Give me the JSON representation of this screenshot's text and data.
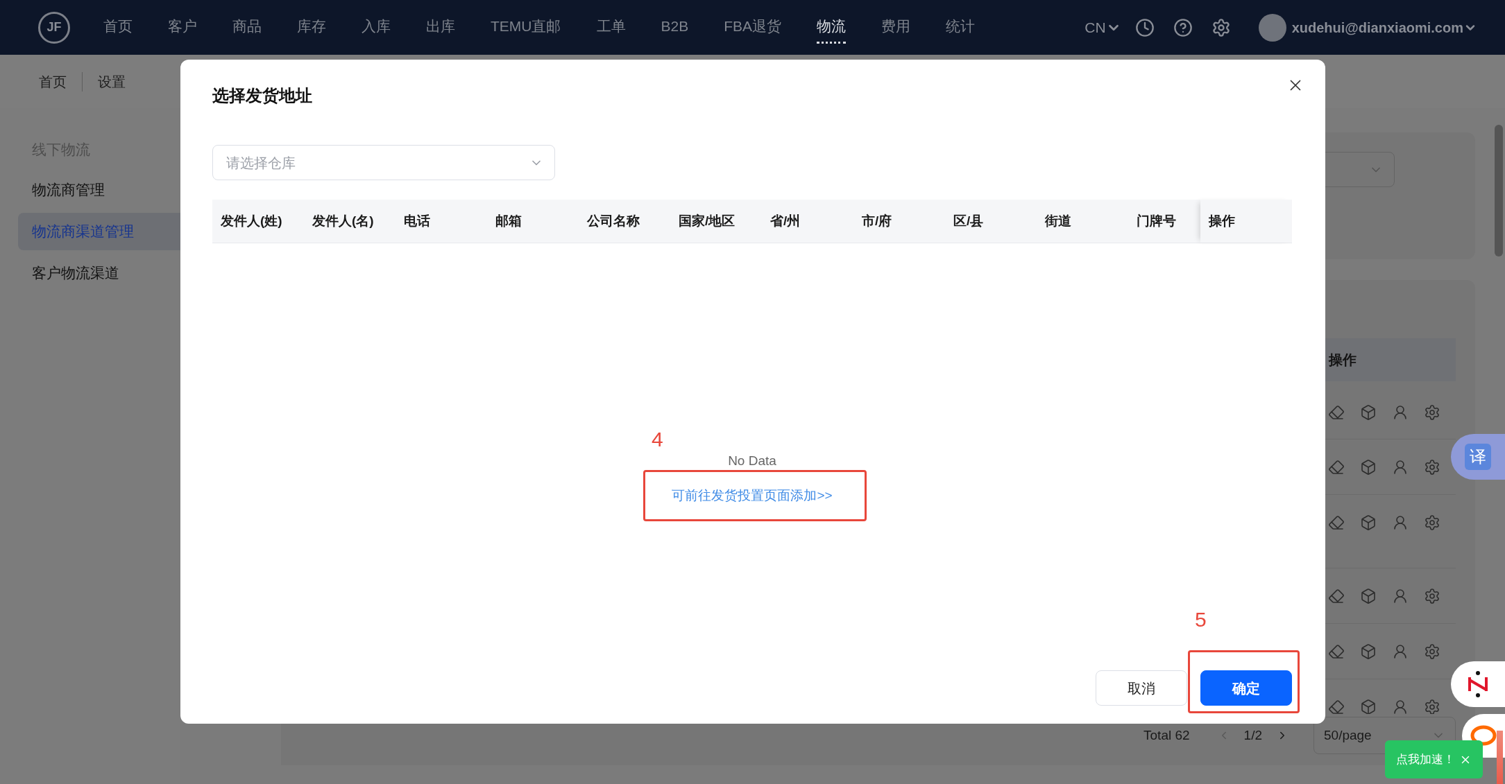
{
  "top_nav": {
    "logo": "JF",
    "items": [
      {
        "label": "首页",
        "selected": false
      },
      {
        "label": "客户",
        "selected": false
      },
      {
        "label": "商品",
        "selected": false
      },
      {
        "label": "库存",
        "selected": false
      },
      {
        "label": "入库",
        "selected": false
      },
      {
        "label": "出库",
        "selected": false
      },
      {
        "label": "TEMU直邮",
        "selected": false
      },
      {
        "label": "工单",
        "selected": false
      },
      {
        "label": "B2B",
        "selected": false
      },
      {
        "label": "FBA退货",
        "selected": false
      },
      {
        "label": "物流",
        "selected": true
      },
      {
        "label": "费用",
        "selected": false
      },
      {
        "label": "统计",
        "selected": false
      }
    ],
    "language": "CN",
    "user": "xudehui@dianxiaomi.com"
  },
  "page_tabs": [
    "首页",
    "设置"
  ],
  "sidebar": {
    "section": "线下物流",
    "items": [
      {
        "label": "物流商管理",
        "selected": false
      },
      {
        "label": "物流商渠道管理",
        "selected": true
      },
      {
        "label": "客户物流渠道",
        "selected": false
      }
    ]
  },
  "background_table": {
    "action_column": "操作"
  },
  "pagination": {
    "total": "Total 62",
    "page": "1/2",
    "page_size": "50/page"
  },
  "dialog": {
    "title": "选择发货地址",
    "warehouse_select": {
      "placeholder": "请选择仓库"
    },
    "table": {
      "columns": [
        "发件人(姓)",
        "发件人(名)",
        "电话",
        "邮箱",
        "公司名称",
        "国家/地区",
        "省/州",
        "市/府",
        "区/县",
        "街道",
        "门牌号"
      ],
      "fixed_column": "操作"
    },
    "empty_text": "No Data",
    "add_link": "可前往发货投置页面添加>>",
    "buttons": [
      {
        "label": "取消",
        "kind": "secondary"
      },
      {
        "label": "确定",
        "kind": "primary"
      }
    ]
  },
  "annotations": [
    "4",
    "5"
  ],
  "widgets": {
    "translate": "译",
    "toast": "点我加速！"
  }
}
